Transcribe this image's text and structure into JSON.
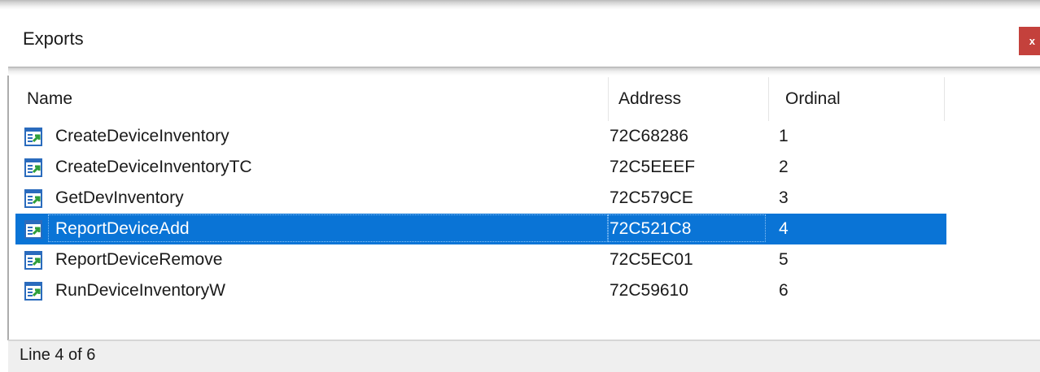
{
  "window": {
    "title": "Exports",
    "close_label": "x"
  },
  "columns": {
    "name": "Name",
    "address": "Address",
    "ordinal": "Ordinal"
  },
  "rows": [
    {
      "name": "CreateDeviceInventory",
      "address": "72C68286",
      "ordinal": "1",
      "selected": false
    },
    {
      "name": "CreateDeviceInventoryTC",
      "address": "72C5EEEF",
      "ordinal": "2",
      "selected": false
    },
    {
      "name": "GetDevInventory",
      "address": "72C579CE",
      "ordinal": "3",
      "selected": false
    },
    {
      "name": "ReportDeviceAdd",
      "address": "72C521C8",
      "ordinal": "4",
      "selected": true
    },
    {
      "name": "ReportDeviceRemove",
      "address": "72C5EC01",
      "ordinal": "5",
      "selected": false
    },
    {
      "name": "RunDeviceInventoryW",
      "address": "72C59610",
      "ordinal": "6",
      "selected": false
    }
  ],
  "status": {
    "text": "Line 4 of 6"
  },
  "icons": {
    "row_icon": "export-function-icon",
    "close_icon": "close-icon"
  },
  "colors": {
    "selection": "#0a74d6",
    "close_button": "#c4413c"
  }
}
